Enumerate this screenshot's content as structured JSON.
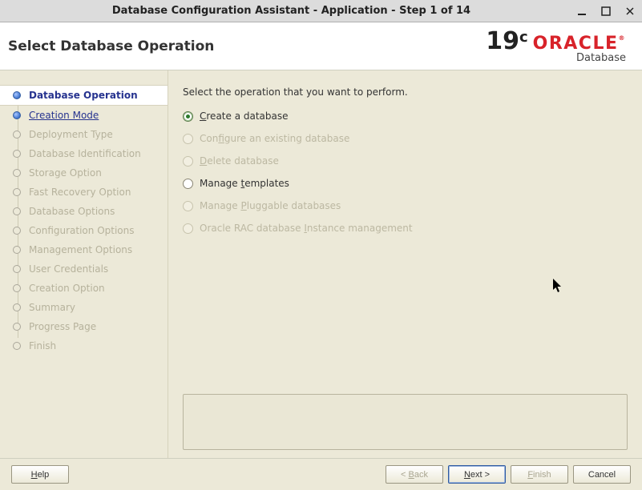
{
  "window": {
    "title": "Database Configuration Assistant - Application - Step 1 of 14"
  },
  "header": {
    "page_title": "Select Database Operation",
    "version": "19",
    "version_suffix": "c",
    "brand": "ORACLE",
    "brand_sub": "Database"
  },
  "sidebar": {
    "steps": [
      {
        "label": "Database Operation",
        "state": "active"
      },
      {
        "label": "Creation Mode",
        "state": "complete"
      },
      {
        "label": "Deployment Type",
        "state": "pending"
      },
      {
        "label": "Database Identification",
        "state": "pending"
      },
      {
        "label": "Storage Option",
        "state": "pending"
      },
      {
        "label": "Fast Recovery Option",
        "state": "pending"
      },
      {
        "label": "Database Options",
        "state": "pending"
      },
      {
        "label": "Configuration Options",
        "state": "pending"
      },
      {
        "label": "Management Options",
        "state": "pending"
      },
      {
        "label": "User Credentials",
        "state": "pending"
      },
      {
        "label": "Creation Option",
        "state": "pending"
      },
      {
        "label": "Summary",
        "state": "pending"
      },
      {
        "label": "Progress Page",
        "state": "pending"
      },
      {
        "label": "Finish",
        "state": "pending"
      }
    ]
  },
  "content": {
    "instruction": "Select the operation that you want to perform.",
    "options": [
      {
        "pre": "",
        "mn": "C",
        "post": "reate a database",
        "state": "selected"
      },
      {
        "pre": "Con",
        "mn": "f",
        "post": "igure an existing database",
        "state": "disabled"
      },
      {
        "pre": "",
        "mn": "D",
        "post": "elete database",
        "state": "disabled"
      },
      {
        "pre": "Manage ",
        "mn": "t",
        "post": "emplates",
        "state": "enabled"
      },
      {
        "pre": "Manage ",
        "mn": "P",
        "post": "luggable databases",
        "state": "disabled"
      },
      {
        "pre": "Oracle RAC database ",
        "mn": "I",
        "post": "nstance management",
        "state": "disabled"
      }
    ]
  },
  "footer": {
    "help_pre": "",
    "help_mn": "H",
    "help_post": "elp",
    "back_pre": "< ",
    "back_mn": "B",
    "back_post": "ack",
    "next_pre": "",
    "next_mn": "N",
    "next_post": "ext >",
    "finish_pre": "",
    "finish_mn": "F",
    "finish_post": "inish",
    "cancel": "Cancel"
  }
}
